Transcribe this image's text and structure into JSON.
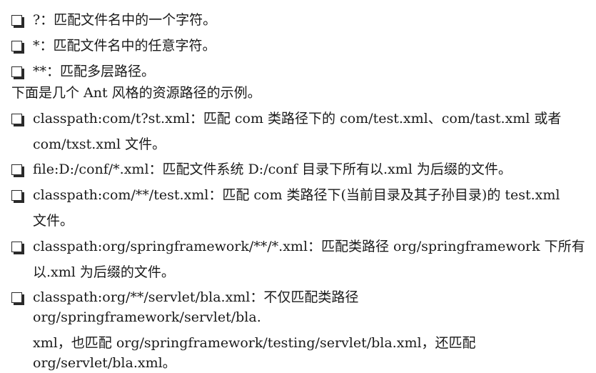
{
  "items": [
    {
      "text": "?：匹配文件名中的一个字符。"
    },
    {
      "text": "*：匹配文件名中的任意字符。"
    },
    {
      "text": "**：匹配多层路径。"
    }
  ],
  "intro": "下面是几个 Ant 风格的资源路径的示例。",
  "examples": [
    {
      "line1": "classpath:com/t?st.xml：匹配 com 类路径下的 com/test.xml、com/tast.xml 或者",
      "line2": "com/txst.xml 文件。"
    },
    {
      "line1": "file:D:/conf/*.xml：匹配文件系统 D:/conf 目录下所有以.xml 为后缀的文件。",
      "line2": ""
    },
    {
      "line1": "classpath:com/**/test.xml：匹配 com 类路径下(当前目录及其子孙目录)的 test.xml",
      "line2": "文件。"
    },
    {
      "line1": "classpath:org/springframework/**/*.xml：匹配类路径 org/springframework 下所有",
      "line2": "以.xml 为后缀的文件。"
    },
    {
      "line1": "classpath:org/**/servlet/bla.xml：不仅匹配类路径 org/springframework/servlet/bla.",
      "line2": "xml，也匹配 org/springframework/testing/servlet/bla.xml，还匹配 org/servlet/bla.xml。"
    }
  ]
}
